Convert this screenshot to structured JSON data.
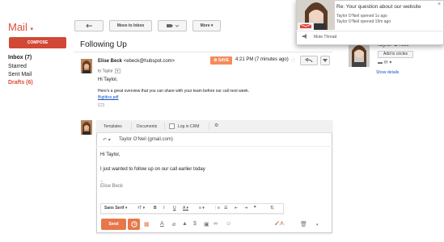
{
  "sidebar": {
    "brand": "Mail",
    "brand_caret": "▾",
    "compose_label": "COMPOSE",
    "items": [
      {
        "label": "Inbox (7)"
      },
      {
        "label": "Starred"
      },
      {
        "label": "Sent Mail"
      },
      {
        "label": "Drafts (6)"
      }
    ]
  },
  "toolbar": {
    "back_icon": "back-arrow-icon",
    "move_to_inbox_label": "Move to Inbox",
    "labels_icon": "label-icon",
    "more_label": "More"
  },
  "thread": {
    "subject": "Following Up"
  },
  "message": {
    "sender_name": "Elise Beck",
    "sender_email": "<ebeck@hubspot.com>",
    "to_line": "to Taylor",
    "save_badge": "SAVE",
    "time": "4:21 PM (7 minutes ago)",
    "greeting": "Hi Taylor,",
    "body": "Here's a great overview that you can share with your team before our call next week.",
    "attachment_link": "Bigtitiss.pdf"
  },
  "composer": {
    "templates_label": "Templates",
    "documents_label": "Documents",
    "log_in_crm_label": "Log in CRM",
    "recipient": "Taylor O'Neil (gmail.com)",
    "greeting": "Hi Taylor,",
    "body_line": "I just wanted to follow up on our call earlier today",
    "sig_dash": "--",
    "signature": "Elise Beck",
    "font_label": "Sans Serif",
    "send_label": "Send"
  },
  "profile": {
    "name": "Taylor O'Neil",
    "add_to_circles_label": "Add to circles",
    "show_details_label": "Show details"
  },
  "notification": {
    "title": "Re: Your question about our website",
    "line1": "Taylor O'Neil opened 1s ago",
    "line2": "Taylor O'Neil opened 19m ago",
    "mute_label": "Mute Thread",
    "close_glyph": "×"
  },
  "colors": {
    "brand_red": "#dd4b39",
    "compose_red": "#d14836",
    "hubspot_orange": "#f58b5a",
    "send_orange": "#e67849",
    "link_blue": "#1155cc"
  }
}
